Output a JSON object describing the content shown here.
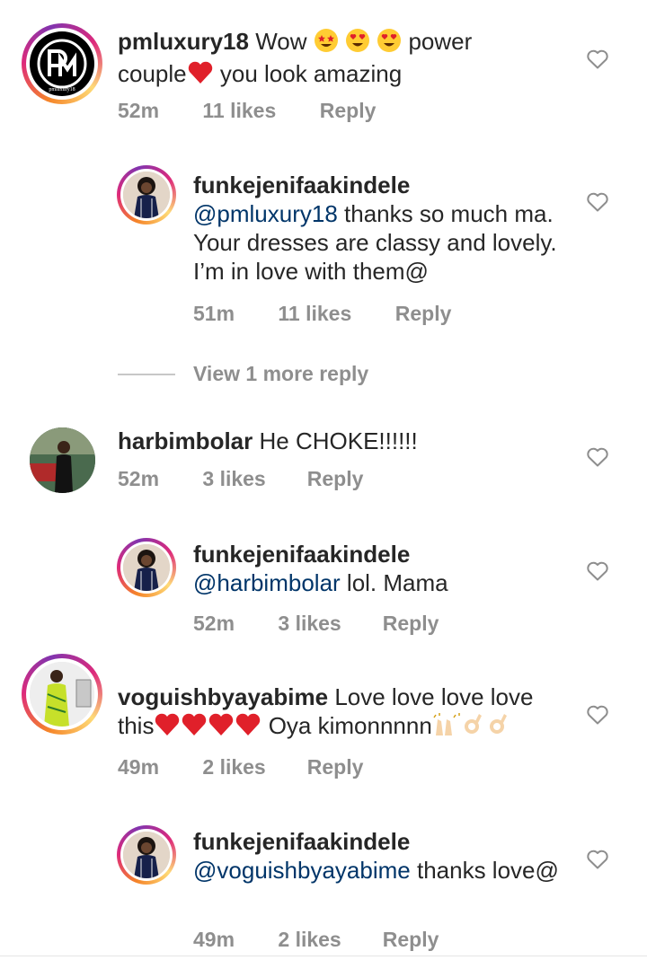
{
  "comments": [
    {
      "username": "pmluxury18",
      "text_before": "Wow",
      "text_after": "power couple",
      "text_tail": "you look amazing",
      "time": "52m",
      "likes": "11 likes",
      "reply": "Reply",
      "avatar_logo_text": "PM",
      "avatar_brand": "pmluxury18"
    },
    {
      "username": "funkejenifaakindele",
      "mention": "@pmluxury18",
      "text": "thanks so much ma. Your dresses are classy and lovely. I’m in love with them@",
      "time": "51m",
      "likes": "11 likes",
      "reply": "Reply"
    },
    {
      "username": "harbimbolar",
      "text": "He CHOKE!!!!!!",
      "time": "52m",
      "likes": "3 likes",
      "reply": "Reply"
    },
    {
      "username": "funkejenifaakindele",
      "mention": "@harbimbolar",
      "text": "lol. Mama",
      "time": "52m",
      "likes": "3 likes",
      "reply": "Reply"
    },
    {
      "username": "voguishbyayabime",
      "text": "Love love love love this",
      "text_tail": "Oya kimonnnnn",
      "time": "49m",
      "likes": "2 likes",
      "reply": "Reply"
    },
    {
      "username": "funkejenifaakindele",
      "mention": "@voguishbyayabime",
      "text": "thanks love@",
      "time": "49m",
      "likes": "2 likes",
      "reply": "Reply"
    }
  ],
  "view_more": "View 1 more reply",
  "icons": {
    "like": "heart-outline-icon"
  },
  "colors": {
    "text": "#262626",
    "secondary": "#8e8e8e",
    "mention": "#003569",
    "heart_emoji": "#e0202a"
  }
}
